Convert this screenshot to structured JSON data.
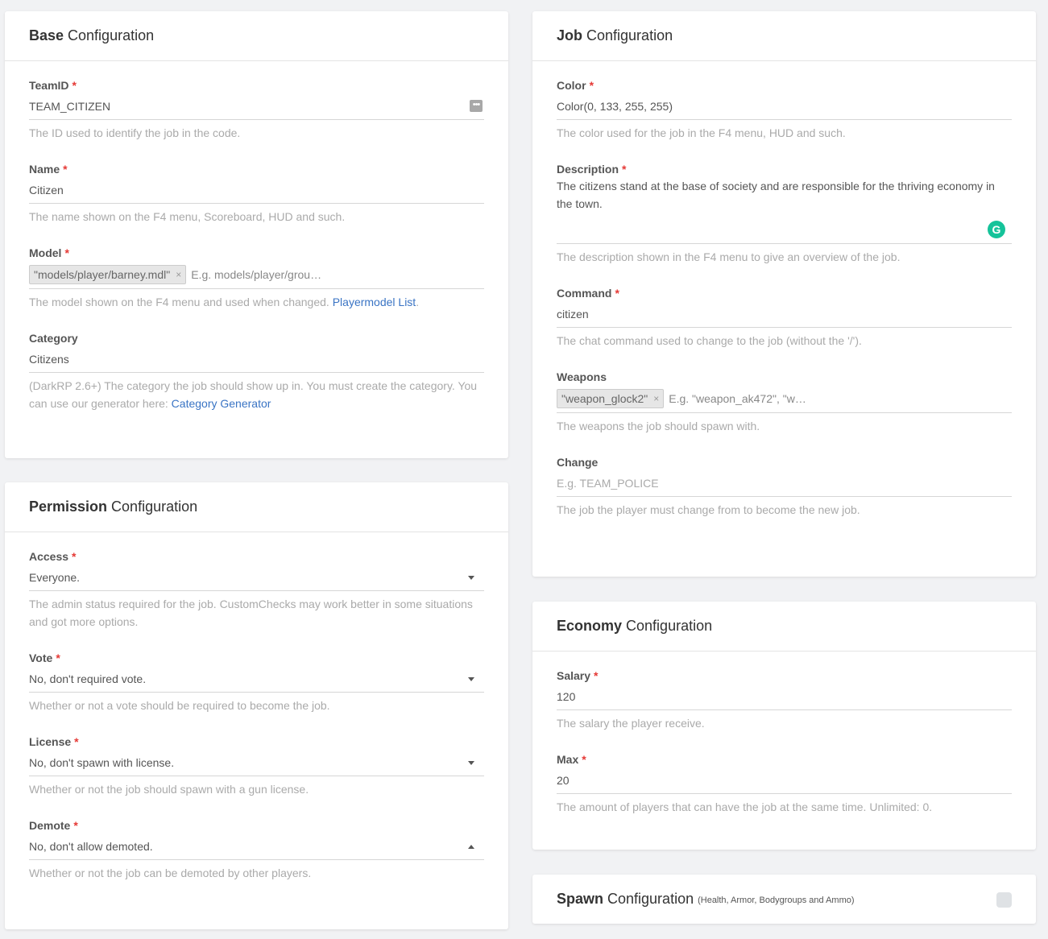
{
  "base": {
    "title_bold": "Base",
    "title_rest": "Configuration",
    "teamid": {
      "label": "TeamID",
      "value": "TEAM_CITIZEN",
      "help": "The ID used to identify the job in the code."
    },
    "name": {
      "label": "Name",
      "value": "Citizen",
      "help": "The name shown on the F4 menu, Scoreboard, HUD and such."
    },
    "model": {
      "label": "Model",
      "tag": "\"models/player/barney.mdl\"",
      "tag_remove": "×",
      "placeholder": "E.g. models/player/grou…",
      "help": "The model shown on the F4 menu and used when changed.",
      "link": "Playermodel List",
      "help_end": "."
    },
    "category": {
      "label": "Category",
      "value": "Citizens",
      "help": "(DarkRP 2.6+) The category the job should show up in. You must create the category. You can use our generator here:",
      "link": "Category Generator"
    }
  },
  "permission": {
    "title_bold": "Permission",
    "title_rest": "Configuration",
    "access": {
      "label": "Access",
      "value": "Everyone.",
      "help": "The admin status required for the job. CustomChecks may work better in some situations and got more options."
    },
    "vote": {
      "label": "Vote",
      "value": "No, don't required vote.",
      "help": "Whether or not a vote should be required to become the job."
    },
    "license": {
      "label": "License",
      "value": "No, don't spawn with license.",
      "help": "Whether or not the job should spawn with a gun license."
    },
    "demote": {
      "label": "Demote",
      "value": "No, don't allow demoted.",
      "help": "Whether or not the job can be demoted by other players."
    }
  },
  "job": {
    "title_bold": "Job",
    "title_rest": "Configuration",
    "color": {
      "label": "Color",
      "value": "Color(0, 133, 255, 255)",
      "help": "The color used for the job in the F4 menu, HUD and such."
    },
    "description": {
      "label": "Description",
      "value": "The citizens stand at the base of society and are responsible for the thriving economy in the town.",
      "help": "The description shown in the F4 menu to give an overview of the job."
    },
    "command": {
      "label": "Command",
      "value": "citizen",
      "help": "The chat command used to change to the job (without the '/')."
    },
    "weapons": {
      "label": "Weapons",
      "tag": "\"weapon_glock2\"",
      "tag_remove": "×",
      "placeholder": "E.g. \"weapon_ak472\", \"w…",
      "help": "The weapons the job should spawn with."
    },
    "change": {
      "label": "Change",
      "placeholder": "E.g. TEAM_POLICE",
      "help": "The job the player must change from to become the new job."
    }
  },
  "economy": {
    "title_bold": "Economy",
    "title_rest": "Configuration",
    "salary": {
      "label": "Salary",
      "value": "120",
      "help": "The salary the player receive."
    },
    "max": {
      "label": "Max",
      "value": "20",
      "help": "The amount of players that can have the job at the same time. Unlimited: 0."
    }
  },
  "spawn": {
    "title_bold": "Spawn",
    "title_rest": "Configuration",
    "subtitle": "(Health, Armor, Bodygroups and Ammo)"
  },
  "required_mark": "*",
  "grammarly_letter": "G",
  "dots": "•••",
  "colors": {
    "required": "#e53935",
    "link": "#3a74c4",
    "grammarly": "#15c39a"
  }
}
